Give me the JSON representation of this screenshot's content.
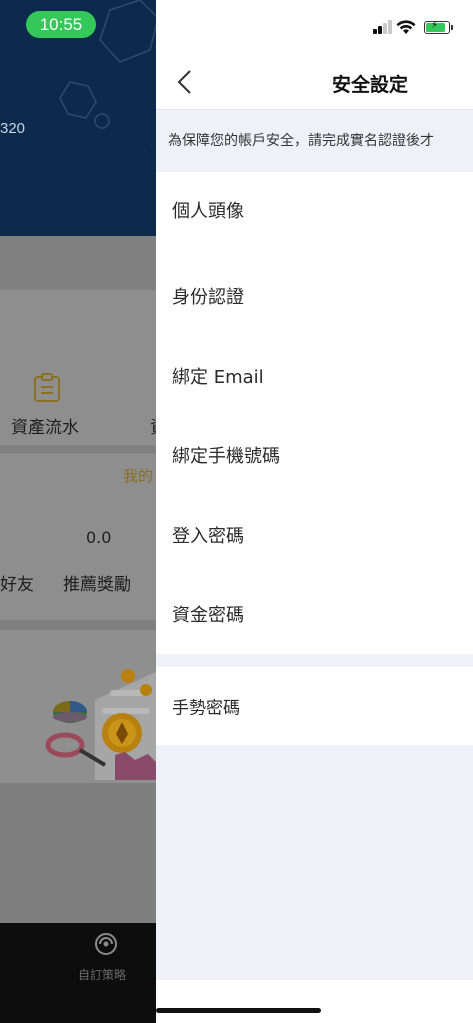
{
  "status_bar": {
    "time": "10:55"
  },
  "background_page": {
    "account_number_fragment": "320",
    "menu_label_1": "資產流水",
    "menu_label_2_fragment": "資",
    "section_label_fragment": "我的",
    "reward_value": "0.0",
    "label_friends_fragment": "好友",
    "label_reward": "推薦獎勵",
    "tab_label": "自訂策略"
  },
  "nav": {
    "title": "安全設定"
  },
  "notice": "為保障您的帳戶安全，請完成實名認證後才",
  "settings": {
    "group1": [
      "個人頭像",
      "身份認證",
      "綁定 Email",
      "綁定手機號碼",
      "登入密碼",
      "資金密碼"
    ],
    "group2": [
      "手勢密碼"
    ]
  },
  "colors": {
    "accent_green": "#34c759",
    "navy": "#0b2a4c",
    "panel_bg": "#eef2f8",
    "gold": "#c9a227"
  }
}
